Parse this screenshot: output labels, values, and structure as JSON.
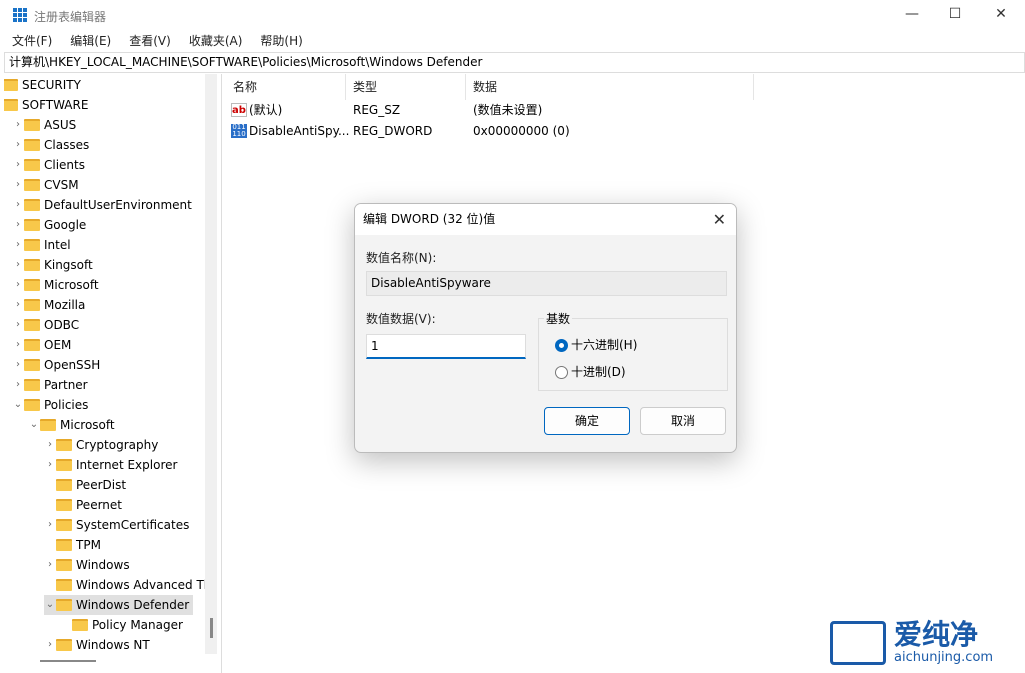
{
  "window": {
    "title": "注册表编辑器",
    "minimize": "—",
    "maximize": "☐",
    "close": "✕"
  },
  "menu": [
    "文件(F)",
    "编辑(E)",
    "查看(V)",
    "收藏夹(A)",
    "帮助(H)"
  ],
  "address": "计算机\\HKEY_LOCAL_MACHINE\\SOFTWARE\\Policies\\Microsoft\\Windows Defender",
  "tree": [
    {
      "label": "SECURITY",
      "level": 0,
      "chevron": ""
    },
    {
      "label": "SOFTWARE",
      "level": 0,
      "chevron": ""
    },
    {
      "label": "ASUS",
      "level": 1,
      "chevron": "›"
    },
    {
      "label": "Classes",
      "level": 1,
      "chevron": "›"
    },
    {
      "label": "Clients",
      "level": 1,
      "chevron": "›"
    },
    {
      "label": "CVSM",
      "level": 1,
      "chevron": "›"
    },
    {
      "label": "DefaultUserEnvironment",
      "level": 1,
      "chevron": "›"
    },
    {
      "label": "Google",
      "level": 1,
      "chevron": "›"
    },
    {
      "label": "Intel",
      "level": 1,
      "chevron": "›"
    },
    {
      "label": "Kingsoft",
      "level": 1,
      "chevron": "›"
    },
    {
      "label": "Microsoft",
      "level": 1,
      "chevron": "›"
    },
    {
      "label": "Mozilla",
      "level": 1,
      "chevron": "›"
    },
    {
      "label": "ODBC",
      "level": 1,
      "chevron": "›"
    },
    {
      "label": "OEM",
      "level": 1,
      "chevron": "›"
    },
    {
      "label": "OpenSSH",
      "level": 1,
      "chevron": "›"
    },
    {
      "label": "Partner",
      "level": 1,
      "chevron": "›"
    },
    {
      "label": "Policies",
      "level": 1,
      "chevron": "⌄"
    },
    {
      "label": "Microsoft",
      "level": 2,
      "chevron": "⌄"
    },
    {
      "label": "Cryptography",
      "level": 3,
      "chevron": "›"
    },
    {
      "label": "Internet Explorer",
      "level": 3,
      "chevron": "›"
    },
    {
      "label": "PeerDist",
      "level": 3,
      "chevron": ""
    },
    {
      "label": "Peernet",
      "level": 3,
      "chevron": ""
    },
    {
      "label": "SystemCertificates",
      "level": 3,
      "chevron": "›"
    },
    {
      "label": "TPM",
      "level": 3,
      "chevron": ""
    },
    {
      "label": "Windows",
      "level": 3,
      "chevron": "›"
    },
    {
      "label": "Windows Advanced Th",
      "level": 3,
      "chevron": ""
    },
    {
      "label": "Windows Defender",
      "level": 3,
      "chevron": "⌄",
      "selected": true
    },
    {
      "label": "Policy Manager",
      "level": 4,
      "chevron": ""
    },
    {
      "label": "Windows NT",
      "level": 3,
      "chevron": "›"
    }
  ],
  "columns": [
    "名称",
    "类型",
    "数据"
  ],
  "values": [
    {
      "icon": "string-value-icon",
      "name": "(默认)",
      "type": "REG_SZ",
      "data": "(数值未设置)"
    },
    {
      "icon": "binary-value-icon",
      "name": "DisableAntiSpy...",
      "type": "REG_DWORD",
      "data": "0x00000000 (0)"
    }
  ],
  "dialog": {
    "title": "编辑 DWORD (32 位)值",
    "name_label": "数值名称(N):",
    "name_value": "DisableAntiSpyware",
    "data_label": "数值数据(V):",
    "data_value": "1",
    "base_label": "基数",
    "hex_label": "十六进制(H)",
    "dec_label": "十进制(D)",
    "selected_base": "hex",
    "ok": "确定",
    "cancel": "取消"
  },
  "watermark": {
    "brand": "爱纯净",
    "url": "aichunjing.com"
  },
  "colors": {
    "accent": "#0067c0",
    "folder": "#f8c84a"
  }
}
